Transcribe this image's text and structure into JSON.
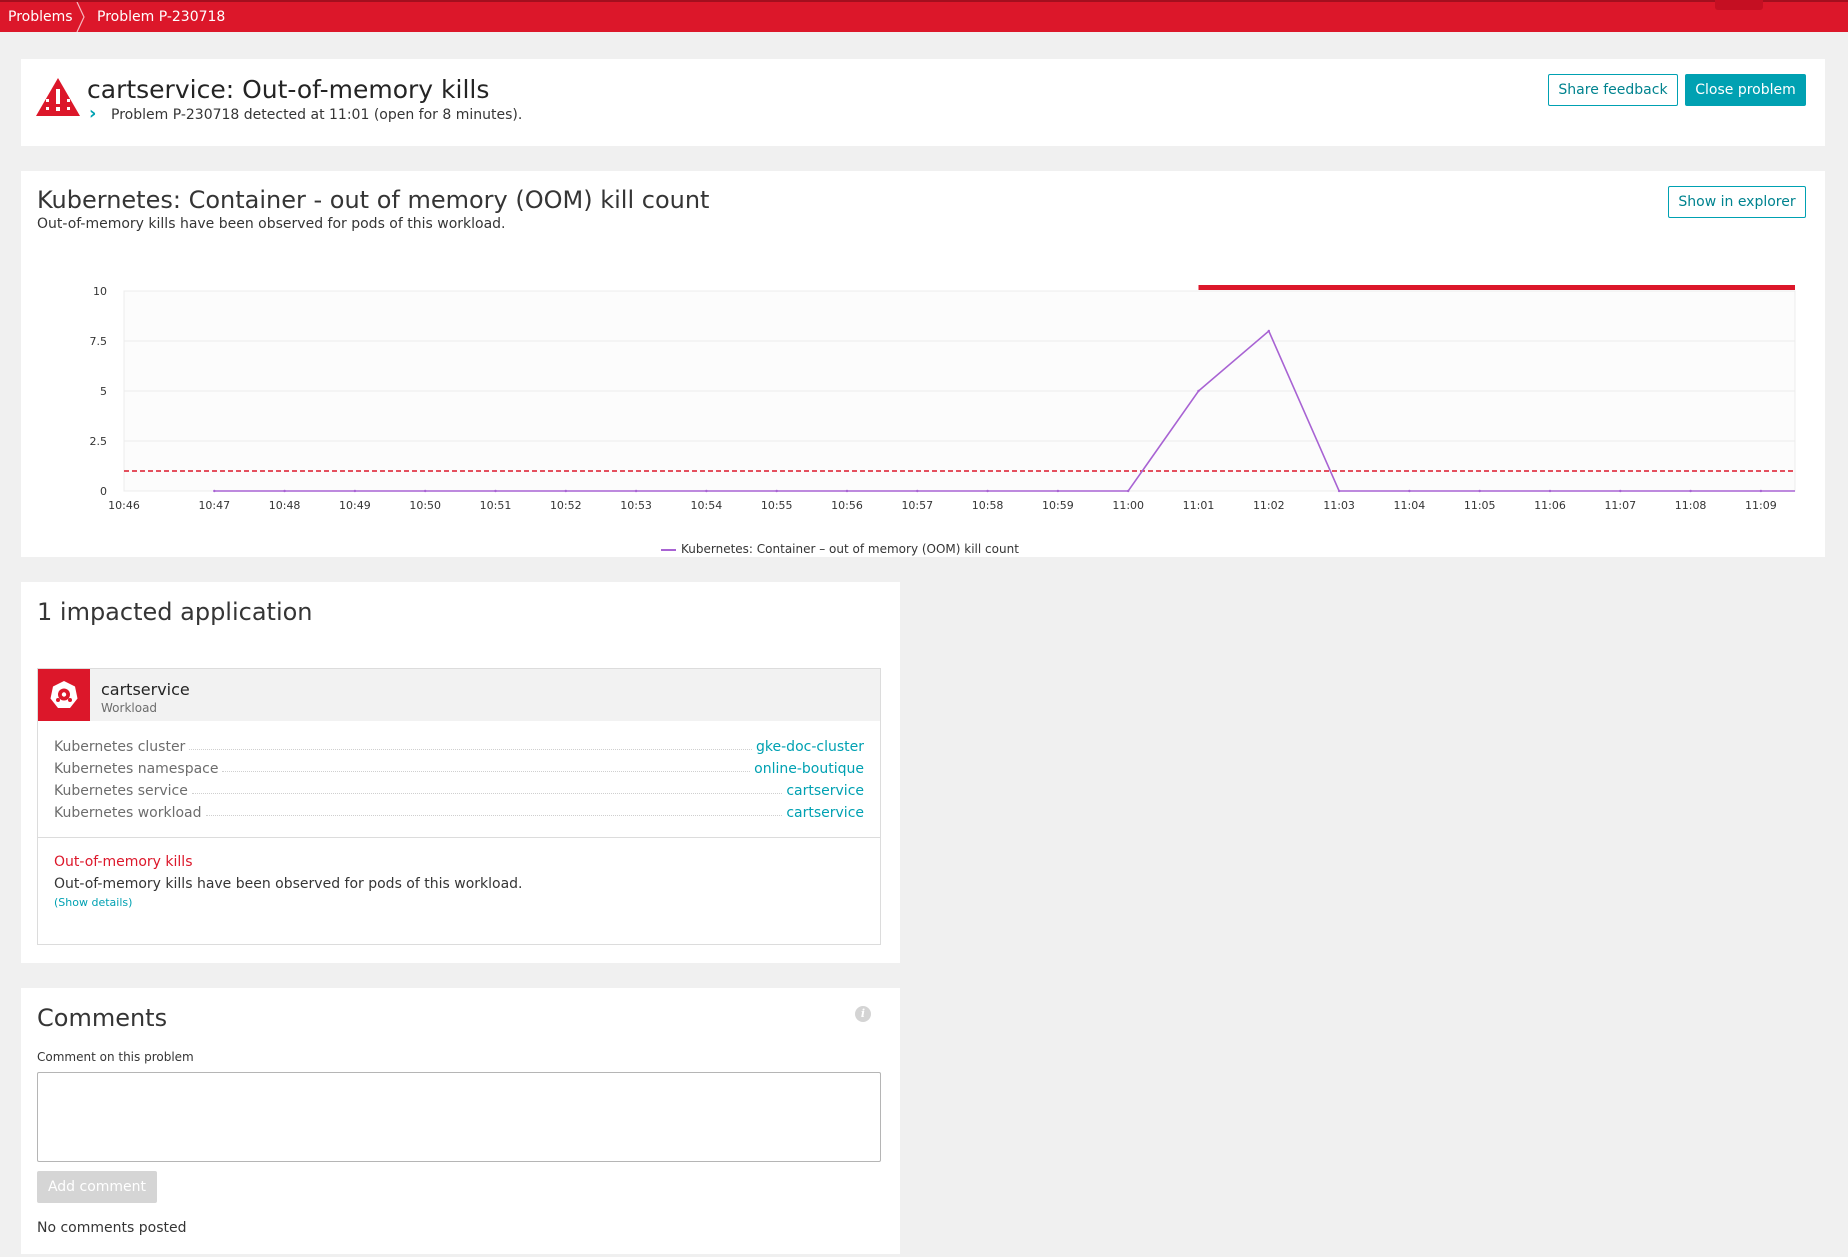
{
  "breadcrumb": {
    "items": [
      "Problems",
      "Problem P-230718"
    ]
  },
  "header": {
    "title": "cartservice: Out-of-memory kills",
    "subtitle": "Problem P-230718 detected at 11:01 (open for 8 minutes).",
    "share_feedback_label": "Share feedback",
    "close_problem_label": "Close problem"
  },
  "metric_card": {
    "title": "Kubernetes: Container - out of memory (OOM) kill count",
    "description": "Out-of-memory kills have been observed for pods of this workload.",
    "show_in_explorer_label": "Show in explorer",
    "legend_label": "Kubernetes: Container – out of memory (OOM) kill count"
  },
  "chart_data": {
    "type": "line",
    "title": "",
    "xlabel": "",
    "ylabel": "",
    "x": [
      "10:46",
      "10:47",
      "10:48",
      "10:49",
      "10:50",
      "10:51",
      "10:52",
      "10:53",
      "10:54",
      "10:55",
      "10:56",
      "10:57",
      "10:58",
      "10:59",
      "11:00",
      "11:01",
      "11:02",
      "11:03",
      "11:04",
      "11:05",
      "11:06",
      "11:07",
      "11:08",
      "11:09"
    ],
    "yticks": [
      "0",
      "2.5",
      "5",
      "7.5",
      "10"
    ],
    "ylim": [
      0,
      10
    ],
    "series": [
      {
        "name": "Kubernetes: Container – out of memory (OOM) kill count",
        "color": "#a863d3",
        "values": [
          null,
          0,
          0,
          0,
          0,
          0,
          0,
          0,
          0,
          0,
          0,
          0,
          0,
          0,
          0,
          5,
          8,
          0,
          0,
          0,
          0,
          0,
          0,
          0
        ]
      }
    ],
    "threshold": 1,
    "threshold_color": "#dc172a",
    "problem_window_start": "11:01",
    "grid": true
  },
  "impacted": {
    "title": "1 impacted application",
    "entity_name": "cartservice",
    "entity_type": "Workload",
    "properties": [
      {
        "key": "Kubernetes cluster",
        "value": "gke-doc-cluster"
      },
      {
        "key": "Kubernetes namespace",
        "value": "online-boutique"
      },
      {
        "key": "Kubernetes service",
        "value": "cartservice"
      },
      {
        "key": "Kubernetes workload",
        "value": "cartservice"
      }
    ],
    "event_title": "Out-of-memory kills",
    "event_description": "Out-of-memory kills have been observed for pods of this workload.",
    "show_details_label": "(Show details)"
  },
  "comments": {
    "title": "Comments",
    "label": "Comment on this problem",
    "add_comment_label": "Add comment",
    "empty_text": "No comments posted"
  },
  "colors": {
    "brand_red": "#dc172a",
    "accent_teal": "#00a1b2"
  }
}
